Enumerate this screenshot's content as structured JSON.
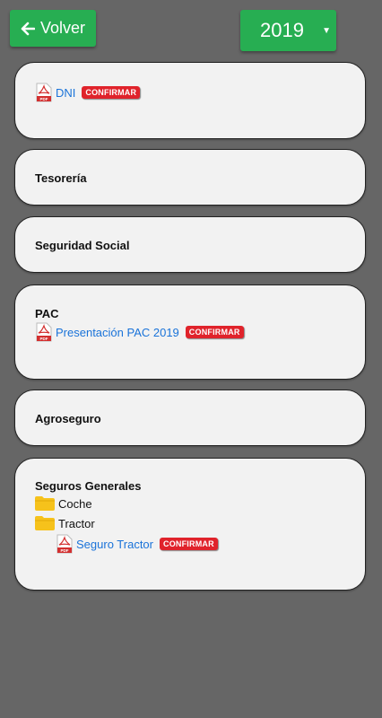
{
  "header": {
    "back_label": "Volver",
    "year_selected": "2019"
  },
  "badge_label": "CONFIRMAR",
  "cards": {
    "dni": {
      "doc": "DNI"
    },
    "tesoreria": {
      "title": "Tesorería"
    },
    "seguridad_social": {
      "title": "Seguridad Social"
    },
    "pac": {
      "title": "PAC",
      "doc": "Presentación PAC 2019"
    },
    "agroseguro": {
      "title": "Agroseguro"
    },
    "seguros_generales": {
      "title": "Seguros Generales",
      "folders": [
        "Coche",
        "Tractor"
      ],
      "doc": "Seguro Tractor"
    }
  },
  "colors": {
    "background": "#666666",
    "primary_button": "#27ae52",
    "card_bg": "#f2f2f2",
    "link": "#1a73d9",
    "badge": "#e0232b"
  }
}
